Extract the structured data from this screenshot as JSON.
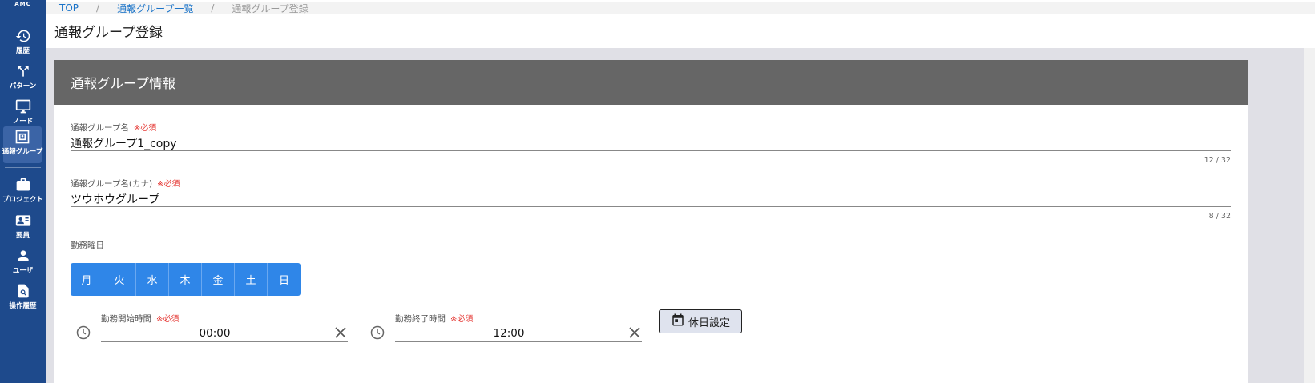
{
  "app": {
    "logo": "AMC"
  },
  "sidebar": {
    "items": [
      {
        "label": "履歴",
        "icon": "history-icon"
      },
      {
        "label": "パターン",
        "icon": "pattern-icon"
      },
      {
        "label": "ノード",
        "icon": "monitor-icon"
      },
      {
        "label": "通報グループ",
        "icon": "group-icon",
        "active": true
      },
      {
        "label": "プロジェクト",
        "icon": "briefcase-icon"
      },
      {
        "label": "要員",
        "icon": "contact-card-icon"
      },
      {
        "label": "ユーザ",
        "icon": "user-icon"
      },
      {
        "label": "操作履歴",
        "icon": "search-document-icon"
      }
    ]
  },
  "breadcrumb": {
    "top": "TOP",
    "list": "通報グループ一覧",
    "current": "通報グループ登録"
  },
  "page": {
    "title": "通報グループ登録"
  },
  "card": {
    "title": "通報グループ情報"
  },
  "form": {
    "name": {
      "label": "通報グループ名",
      "required": "※必須",
      "value": "通報グループ1_copy",
      "counter": "12 / 32"
    },
    "kana": {
      "label": "通報グループ名(カナ)",
      "required": "※必須",
      "value": "ツウホウグループ",
      "counter": "8 / 32"
    },
    "weekdays": {
      "label": "勤務曜日",
      "days": [
        "月",
        "火",
        "水",
        "木",
        "金",
        "土",
        "日"
      ]
    },
    "start": {
      "label": "勤務開始時間",
      "required": "※必須",
      "value": "00:00"
    },
    "end": {
      "label": "勤務終了時間",
      "required": "※必須",
      "value": "12:00"
    },
    "holiday_button": "休日設定"
  },
  "colors": {
    "sidebar": "#1e4a8c",
    "card_header": "#666666",
    "day_button": "#2f86e8",
    "required": "#e53935",
    "link": "#1a73c8"
  }
}
